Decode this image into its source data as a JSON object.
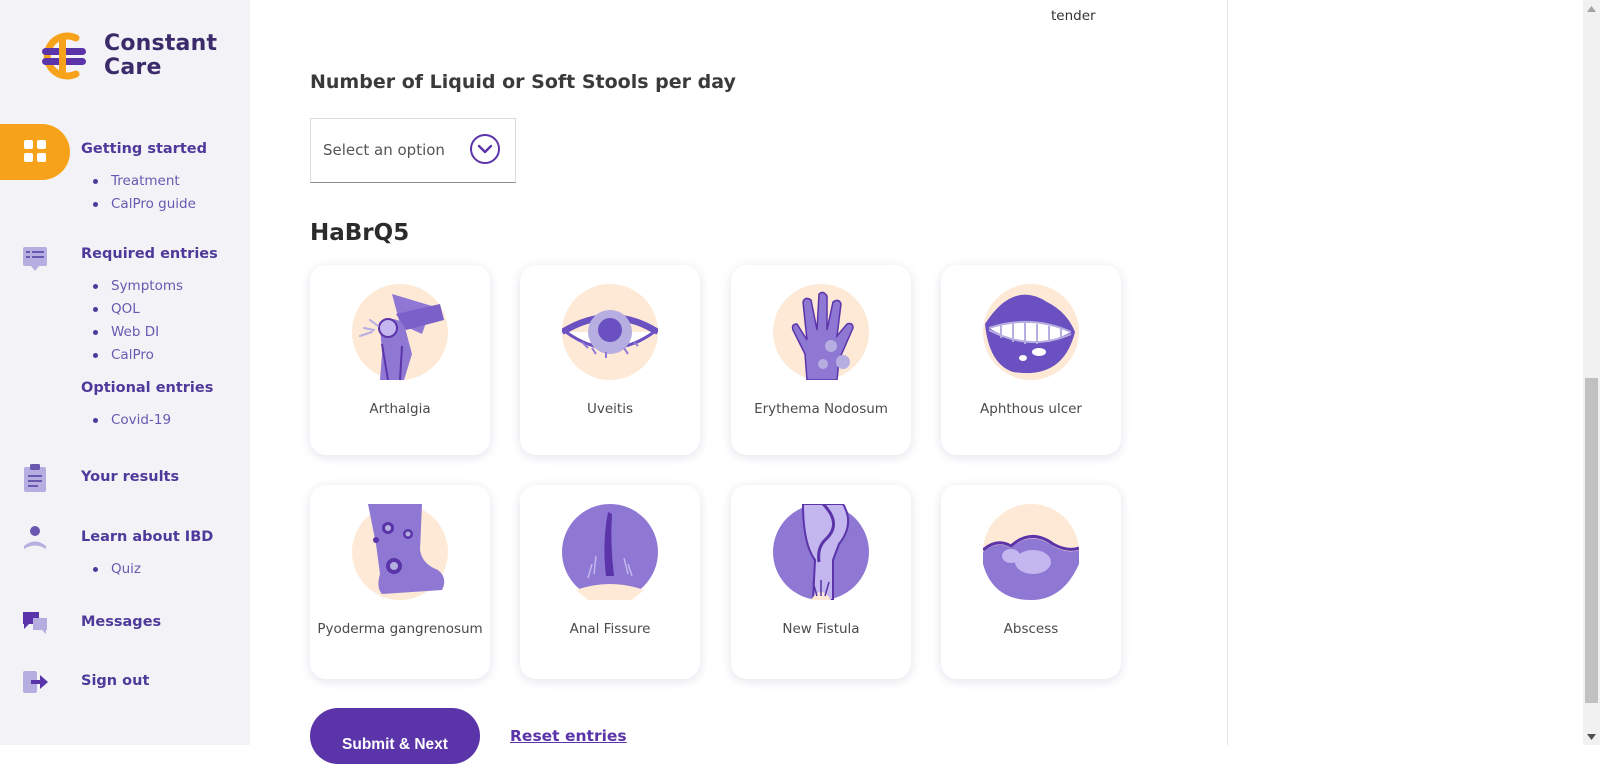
{
  "app": {
    "name_line1": "Constant",
    "name_line2": "Care"
  },
  "sidebar": {
    "getting_started": {
      "label": "Getting started",
      "items": [
        "Treatment",
        "CalPro guide"
      ]
    },
    "required_entries": {
      "label": "Required entries",
      "items": [
        "Symptoms",
        "QOL",
        "Web DI",
        "CalPro"
      ]
    },
    "optional_entries": {
      "label": "Optional entries",
      "items": [
        "Covid-19"
      ]
    },
    "your_results": {
      "label": "Your results"
    },
    "learn_about_ibd": {
      "label": "Learn about IBD",
      "items": [
        "Quiz"
      ]
    },
    "messages": {
      "label": "Messages"
    },
    "sign_out": {
      "label": "Sign out"
    }
  },
  "main": {
    "previous_label": "tender",
    "stools_question": "Number of Liquid or Soft Stools per day",
    "stools_select": {
      "placeholder": "Select an option"
    },
    "section_title": "HaBrQ5",
    "cards": [
      {
        "label": "Arthalgia",
        "icon": "knee-joint-icon"
      },
      {
        "label": "Uveitis",
        "icon": "inflamed-eye-icon"
      },
      {
        "label": "Erythema Nodosum",
        "icon": "hand-nodules-icon"
      },
      {
        "label": "Aphthous ulcer",
        "icon": "mouth-ulcer-icon"
      },
      {
        "label": "Pyoderma gangrenosum",
        "icon": "leg-lesions-icon"
      },
      {
        "label": "Anal Fissure",
        "icon": "anal-fissure-icon"
      },
      {
        "label": "New Fistula",
        "icon": "fistula-icon"
      },
      {
        "label": "Abscess",
        "icon": "abscess-icon"
      }
    ],
    "submit_label": "Submit & Next",
    "reset_label": "Reset entries"
  },
  "colors": {
    "brand_purple": "#5a34a8",
    "nav_purple": "#4e3a9a",
    "accent_orange": "#f7a21b",
    "illustration_bg": "#fde9d6",
    "illustration_purple": "#8f78d4"
  }
}
